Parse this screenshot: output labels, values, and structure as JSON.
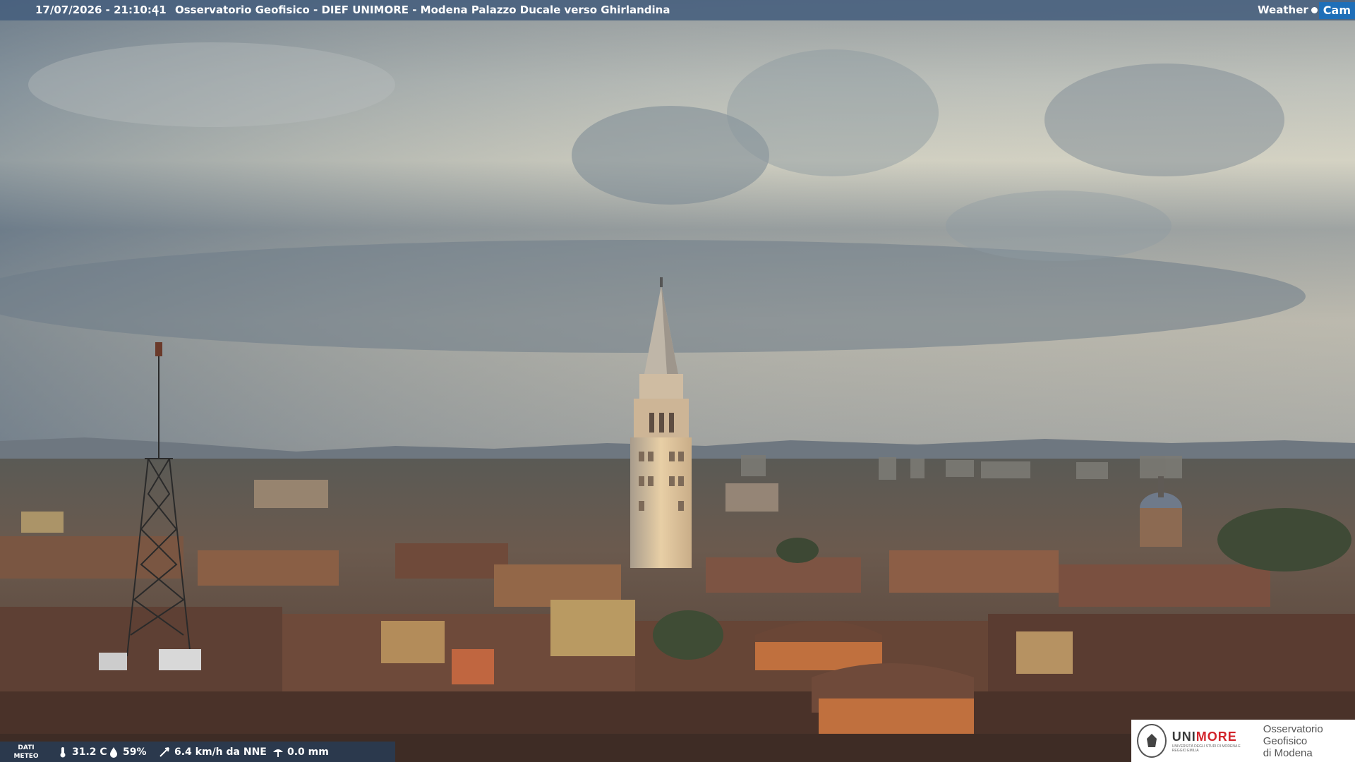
{
  "overlay": {
    "timestamp": "17/07/2026 - 21:10:41",
    "separator": "|",
    "title": "Osservatorio Geofisico - DIEF UNIMORE - Modena Palazzo Ducale verso Ghirlandina",
    "brand_weather": "Weather",
    "brand_cam": "Cam"
  },
  "weather": {
    "label_line1": "DATI",
    "label_line2": "METEO",
    "temperature": "31.2 C",
    "humidity": "59%",
    "wind": "6.4 km/h da NNE",
    "rain": "0.0 mm",
    "icons": [
      "thermometer-icon",
      "humidity-icon",
      "wind-icon",
      "rain-icon"
    ]
  },
  "logo": {
    "name_part1": "UNI",
    "name_part2": "MORE",
    "subtitle": "UNIVERSITÀ DEGLI STUDI DI MODENA E REGGIO EMILIA",
    "observatory_line1": "Osservatorio Geofisico",
    "observatory_line2": "di Modena"
  },
  "colors": {
    "topbar": "#465f7d",
    "brand_cam": "#1f6fb8",
    "unimore_red": "#d2232a"
  }
}
